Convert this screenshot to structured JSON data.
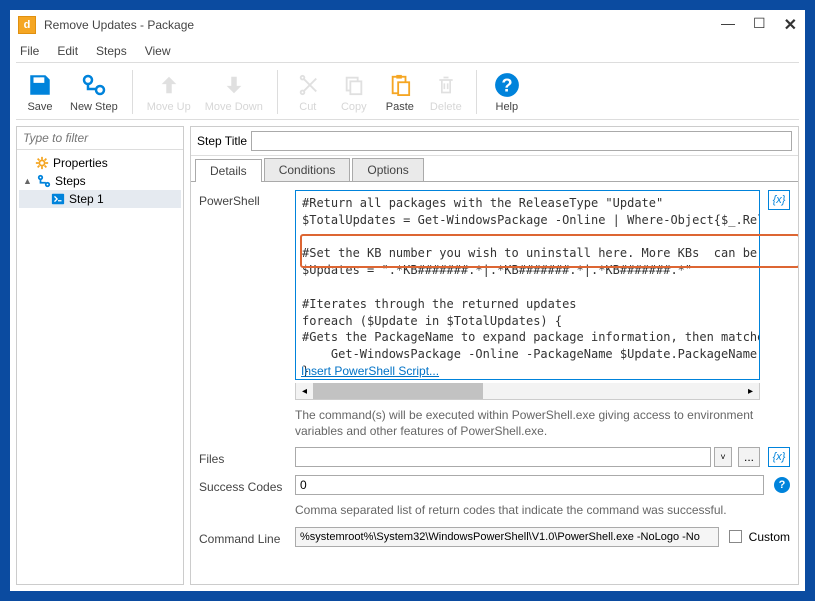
{
  "window": {
    "title": "Remove Updates - Package"
  },
  "menu": {
    "file": "File",
    "edit": "Edit",
    "steps": "Steps",
    "view": "View"
  },
  "toolbar": {
    "save": "Save",
    "new_step": "New Step",
    "move_up": "Move Up",
    "move_down": "Move Down",
    "cut": "Cut",
    "copy": "Copy",
    "paste": "Paste",
    "delete": "Delete",
    "help": "Help"
  },
  "leftpane": {
    "filter_placeholder": "Type to filter",
    "properties": "Properties",
    "steps": "Steps",
    "step1": "Step 1"
  },
  "steptitle": {
    "label": "Step Title",
    "value": ""
  },
  "tabs": {
    "details": "Details",
    "conditions": "Conditions",
    "options": "Options"
  },
  "powershell": {
    "label": "PowerShell",
    "code": "#Return all packages with the ReleaseType \"Update\"\n$TotalUpdates = Get-WindowsPackage -Online | Where-Object{$_.ReleaseTyp\n\n#Set the KB number you wish to uninstall here. More KBs  can be added by\n$Updates = \".*KB#######.*|.*KB#######.*|.*KB#######.*\"\n\n#Iterates through the returned updates\nforeach ($Update in $TotalUpdates) {\n#Gets the PackageName to expand package information, then matches the K\n    Get-WindowsPackage -Online -PackageName $Update.PackageName | W\n}",
    "insert_link": "Insert PowerShell Script...",
    "note": "The command(s) will be executed within PowerShell.exe giving access to environment variables and other features of PowerShell.exe."
  },
  "files": {
    "label": "Files",
    "value": ""
  },
  "success_codes": {
    "label": "Success Codes",
    "value": "0",
    "note": "Comma separated list of return codes that indicate the command was successful."
  },
  "command_line": {
    "label": "Command Line",
    "value": "%systemroot%\\System32\\WindowsPowerShell\\V1.0\\PowerShell.exe -NoLogo -No",
    "custom_label": "Custom"
  }
}
